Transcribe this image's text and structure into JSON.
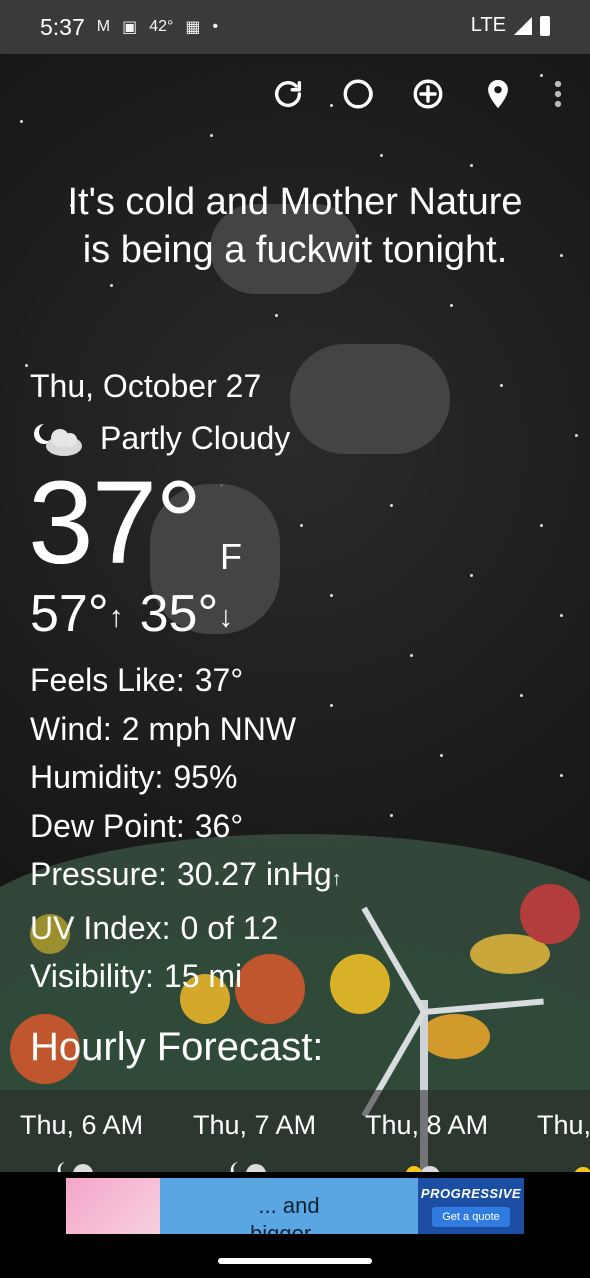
{
  "status_bar": {
    "time": "5:37",
    "icons": [
      "gmail-icon",
      "ge-icon",
      "calendar-icon",
      "dot-icon"
    ],
    "temperature_badge": "42°",
    "network": "LTE"
  },
  "toolbar": {
    "refresh_icon": "refresh-icon",
    "moon_icon": "moon-phase-icon",
    "add_icon": "add-location-icon",
    "location_icon": "location-pin-icon",
    "menu_icon": "more-vert-icon"
  },
  "snark": {
    "line1": "It's cold and Mother Nature",
    "line2": "is being a fuckwit tonight."
  },
  "current": {
    "date": "Thu, October 27",
    "condition": "Partly Cloudy",
    "condition_icon": "partly-cloudy-night-icon",
    "temperature": "37°",
    "unit": "F",
    "high": "57°",
    "low": "35°",
    "high_arrow": "↑",
    "low_arrow": "↓"
  },
  "details": [
    {
      "label": "Feels Like:",
      "value": "37°",
      "suffix": ""
    },
    {
      "label": "Wind:",
      "value": "2 mph NNW",
      "suffix": ""
    },
    {
      "label": "Humidity:",
      "value": "95%",
      "suffix": ""
    },
    {
      "label": "Dew Point:",
      "value": "36°",
      "suffix": ""
    },
    {
      "label": "Pressure:",
      "value": "30.27 inHg",
      "suffix": "↑"
    },
    {
      "label": "UV Index:",
      "value": "0 of 12",
      "suffix": ""
    },
    {
      "label": "Visibility:",
      "value": "15 mi",
      "suffix": ""
    }
  ],
  "hourly": {
    "title": "Hourly Forecast:",
    "items": [
      {
        "time": "Thu, 6 AM",
        "icon": "partly-cloudy-night-icon"
      },
      {
        "time": "Thu, 7 AM",
        "icon": "partly-cloudy-night-icon"
      },
      {
        "time": "Thu, 8 AM",
        "icon": "partly-sunny-icon"
      },
      {
        "time": "Thu,",
        "icon": "sunny-icon"
      }
    ]
  },
  "ad": {
    "text_line1": "... and",
    "text_line2": "bigger",
    "brand": "PROGRESSIVE",
    "cta": "Get a quote"
  },
  "colors": {
    "status_bar": "#3a3a3a",
    "background": "#151515",
    "ad_blue": "#5aa6e3",
    "brand_blue": "#1c4fa3"
  }
}
